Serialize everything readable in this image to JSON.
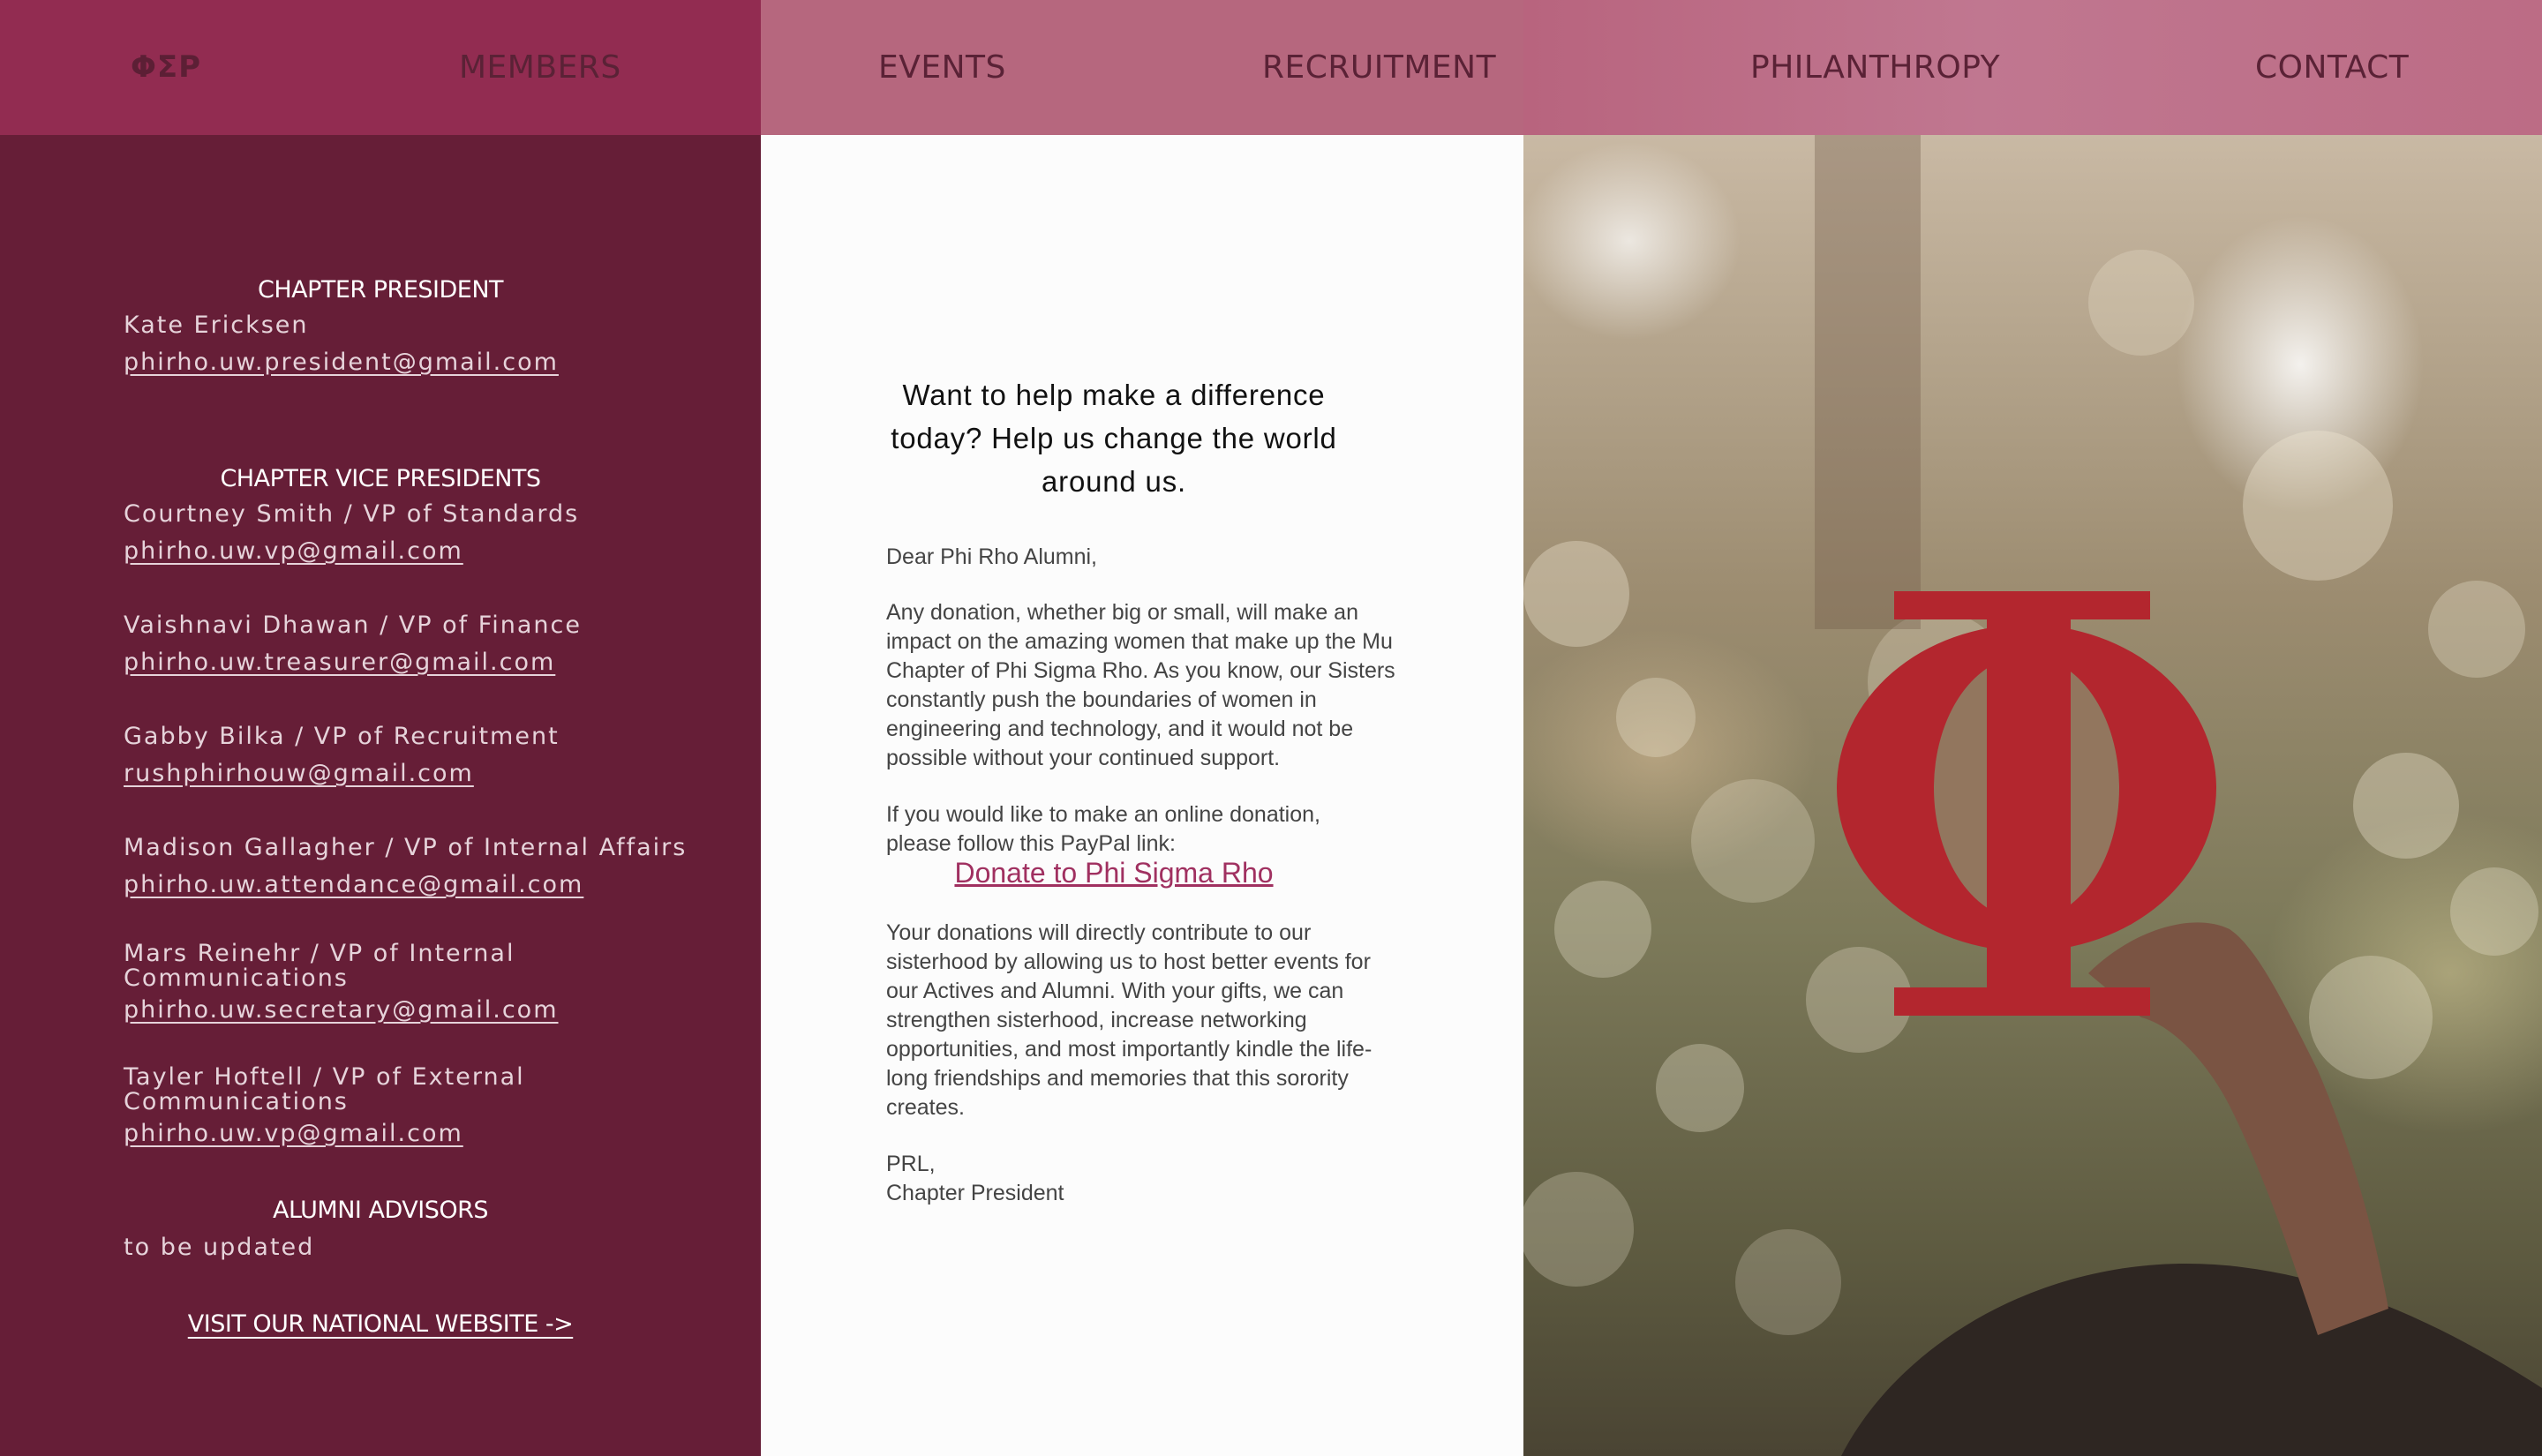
{
  "nav": {
    "logo": "ΦΣΡ",
    "items": [
      "MEMBERS",
      "EVENTS",
      "RECRUITMENT",
      "PHILANTHROPY",
      "CONTACT"
    ]
  },
  "left": {
    "president_heading": "CHAPTER PRESIDENT",
    "president": {
      "name": "Kate Ericksen",
      "email": "phirho.uw.president@gmail.com"
    },
    "vp_heading": "CHAPTER VICE PRESIDENTS",
    "vps": [
      {
        "name": "Courtney Smith / VP of Standards",
        "email": "phirho.uw.vp@gmail.com"
      },
      {
        "name": "Vaishnavi Dhawan / VP of Finance",
        "email": "phirho.uw.treasurer@gmail.com"
      },
      {
        "name": "Gabby Bilka / VP of Recruitment",
        "email": "rushphirhouw@gmail.com"
      },
      {
        "name": "Madison Gallagher / VP of Internal Affairs",
        "email": "phirho.uw.attendance@gmail.com"
      },
      {
        "name": "Mars Reinehr / VP of Internal Communications",
        "email": "phirho.uw.secretary@gmail.com"
      },
      {
        "name": "Tayler Hoftell / VP of External Communications",
        "email": "phirho.uw.vp@gmail.com"
      }
    ],
    "advisors_heading": "ALUMNI ADVISORS",
    "advisors_text": "to be updated",
    "national_link": "VISIT OUR NATIONAL WEBSITE ->"
  },
  "middle": {
    "headline": "Want to help make a difference today? Help us change the world around us.",
    "greeting": "Dear Phi Rho Alumni,",
    "para1": "Any donation, whether big or small, will make an impact on the amazing women that make up the Mu Chapter of Phi Sigma Rho. As you know, our Sisters constantly push the boundaries of women in engineering and technology, and it would not be possible without your continued support.",
    "para2": "If you would like to make an online donation, please follow this PayPal link:",
    "donate_link": "Donate to Phi Sigma Rho",
    "para3": "Your donations will directly contribute to our sisterhood by allowing us to host better events for our Actives and Alumni. With your gifts, we can strengthen sisterhood, increase networking opportunities, and most importantly kindle the life-long friendships and memories that this sorority creates.",
    "signoff1": "PRL,",
    "signoff2": "Chapter President"
  },
  "colors": {
    "nav_left": "#922c51",
    "nav_mid": "#b6677e",
    "left_panel": "#661e37",
    "link_accent": "#a03060",
    "phi_red": "#b3262e"
  },
  "photo": {
    "icon": "phi-letter-icon"
  }
}
